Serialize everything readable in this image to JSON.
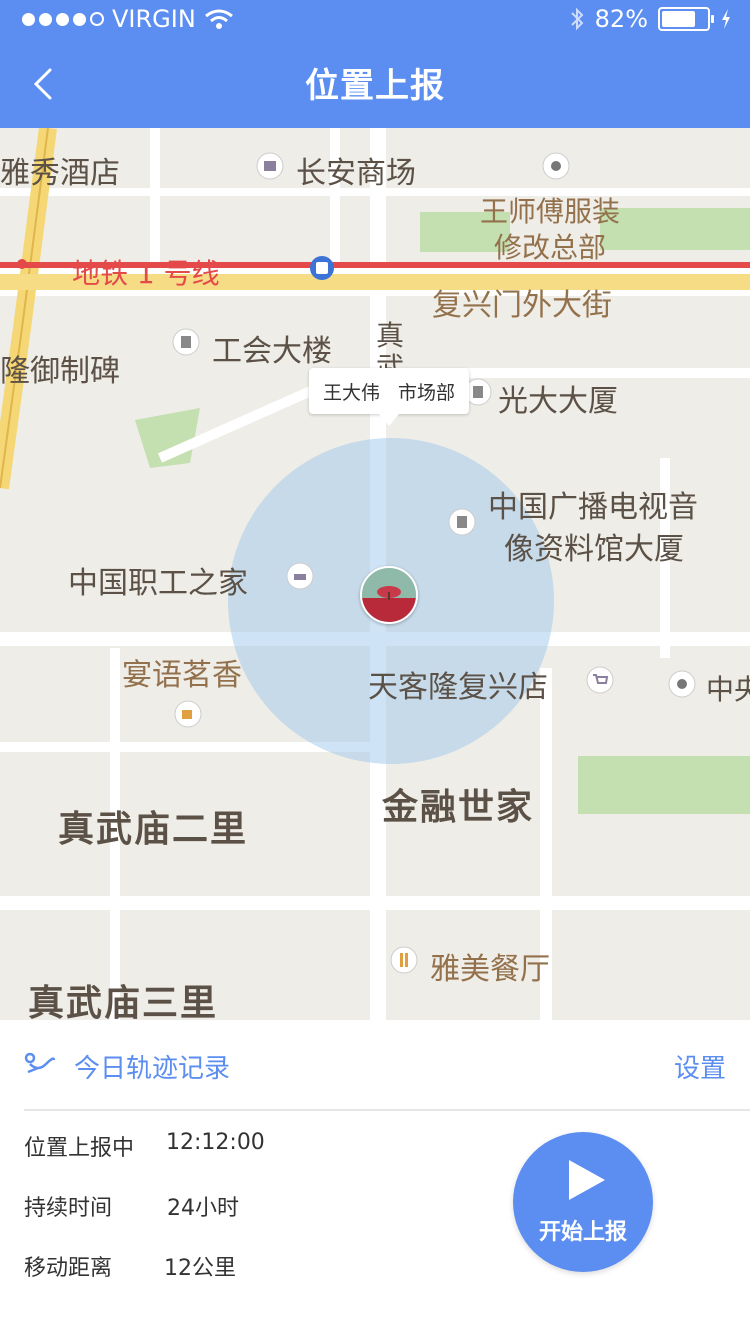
{
  "status_bar": {
    "carrier": "VIRGIN",
    "battery": "82%",
    "battery_level": 0.82
  },
  "header": {
    "title": "位置上报"
  },
  "map": {
    "labels": {
      "hotel": "雅秀酒店",
      "mall": "长安商场",
      "tailor_1": "王师傅服装",
      "tailor_2": "修改总部",
      "metro": "地铁 1 号线",
      "street": "复兴门外大街",
      "union_building": "工会大楼",
      "zhen": "真",
      "wu": "武",
      "stele": "隆御制碑",
      "guangda": "光大大厦",
      "broadcast_1": "中国广播电视音",
      "broadcast_2": "像资料馆大厦",
      "workers_home": "中国职工之家",
      "tea": "宴语茗香",
      "store": "天客隆复兴店",
      "zhongyang": "中央",
      "finance": "金融世家",
      "zwm2": "真武庙二里",
      "restaurant": "雅美餐厅",
      "zwm3": "真武庙三里"
    },
    "marker": {
      "name": "王大伟",
      "department": "市场部"
    }
  },
  "panel": {
    "track_record": "今日轨迹记录",
    "settings": "设置",
    "info": [
      {
        "label": "位置上报中",
        "value": "12:12:00"
      },
      {
        "label": "持续时间",
        "value": "24小时"
      },
      {
        "label": "移动距离",
        "value": "12公里"
      }
    ],
    "start_button": "开始上报"
  }
}
